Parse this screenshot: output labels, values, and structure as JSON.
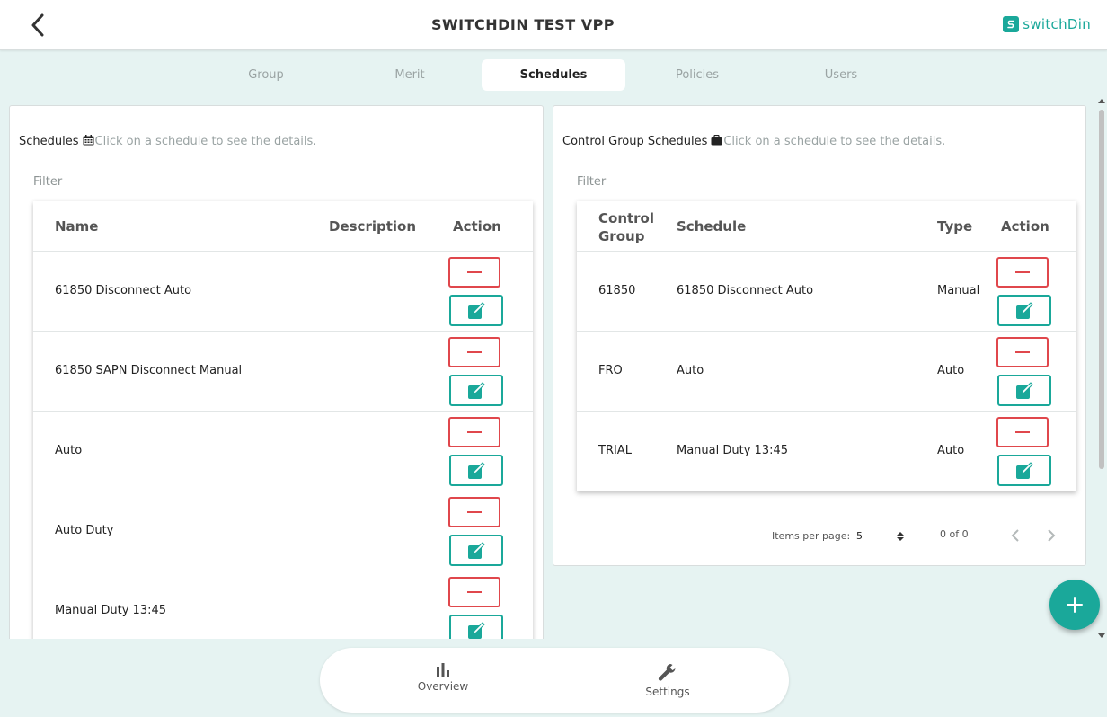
{
  "header": {
    "title": "SWITCHDIN TEST VPP",
    "logo_text": "switchDin",
    "accent": "#1aa89a"
  },
  "tabs": [
    {
      "label": "Group",
      "active": false
    },
    {
      "label": "Merit",
      "active": false
    },
    {
      "label": "Schedules",
      "active": true
    },
    {
      "label": "Policies",
      "active": false
    },
    {
      "label": "Users",
      "active": false
    }
  ],
  "schedules_panel": {
    "title": "Schedules",
    "icon": "calendar-icon",
    "hint": "Click on a schedule to see the details.",
    "filter_label": "Filter",
    "columns": [
      "Name",
      "Description",
      "Action"
    ],
    "rows": [
      {
        "name": "61850 Disconnect Auto",
        "description": ""
      },
      {
        "name": "61850 SAPN Disconnect Manual",
        "description": ""
      },
      {
        "name": "Auto",
        "description": ""
      },
      {
        "name": "Auto Duty",
        "description": ""
      },
      {
        "name": "Manual Duty 13:45",
        "description": ""
      }
    ]
  },
  "control_group_panel": {
    "title": "Control Group Schedules",
    "icon": "briefcase-icon",
    "hint": "Click on a schedule to see the details.",
    "filter_label": "Filter",
    "columns": [
      "Control Group",
      "Schedule",
      "Type",
      "Action"
    ],
    "rows": [
      {
        "control_group": "61850",
        "schedule": "61850 Disconnect Auto",
        "type": "Manual"
      },
      {
        "control_group": "FRO",
        "schedule": "Auto",
        "type": "Auto"
      },
      {
        "control_group": "TRIAL",
        "schedule": "Manual Duty 13:45",
        "type": "Auto"
      }
    ],
    "paginator": {
      "items_per_page_label": "Items per page:",
      "items_per_page": "5",
      "range": "0 of 0"
    }
  },
  "bottom_nav": [
    {
      "label": "Overview",
      "icon": "bar-chart-icon"
    },
    {
      "label": "Settings",
      "icon": "wrench-icon"
    }
  ]
}
